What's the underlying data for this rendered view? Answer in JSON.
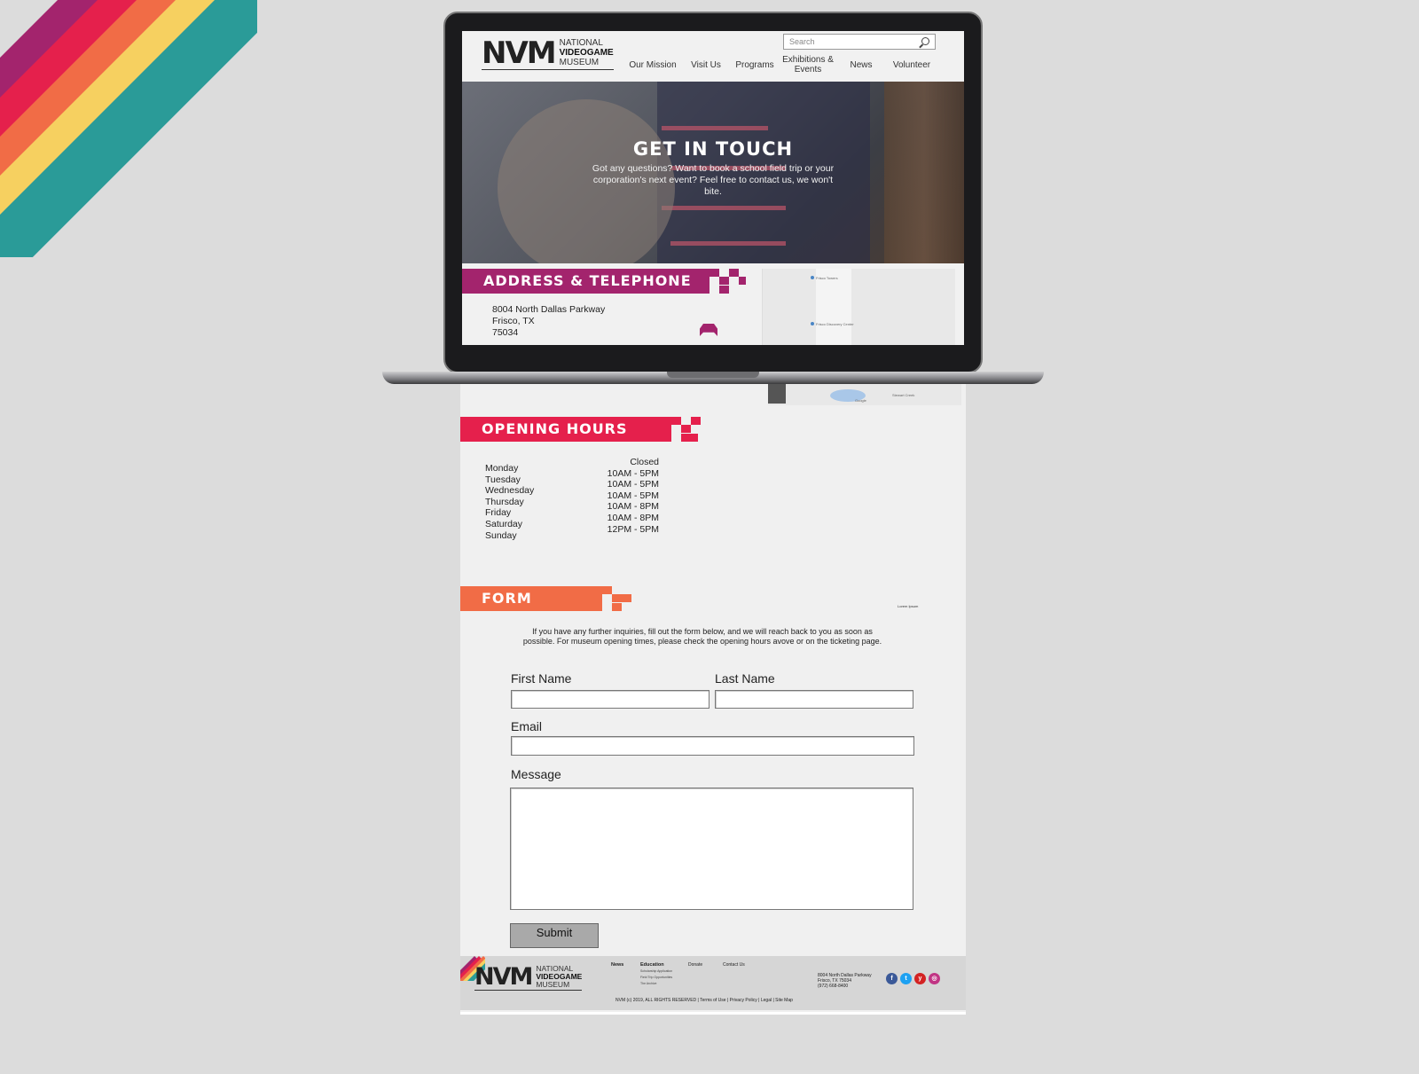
{
  "site": {
    "logo_mark": "NVM",
    "logo_line1": "NATIONAL",
    "logo_line2": "VIDEOGAME",
    "logo_line3": "MUSEUM"
  },
  "header": {
    "search_placeholder": "Search",
    "nav": [
      "Our Mission",
      "Visit Us",
      "Programs",
      "Exhibitions & Events",
      "News",
      "Volunteer"
    ]
  },
  "hero": {
    "title": "GET IN TOUCH",
    "text": "Got any questions? Want to book a school field trip or your corporation's next event? Feel free to contact us, we won't bite."
  },
  "address_section": {
    "title": "ADDRESS & TELEPHONE",
    "line1": "8004 North Dallas Parkway",
    "line2": "Frisco, TX",
    "line3": "75034",
    "map_label1": "Frisco Towers",
    "map_label2": "Frisco Discovery Center",
    "map_google": "Google",
    "map_label3": "Stewart Creek"
  },
  "hours_section": {
    "title": "OPENING HOURS",
    "days": [
      "Monday",
      "Tuesday",
      "Wednesday",
      "Thursday",
      "Friday",
      "Saturday",
      "Sunday"
    ],
    "times": [
      "Closed",
      "10AM - 5PM",
      "10AM - 5PM",
      "10AM - 5PM",
      "10AM - 8PM",
      "10AM - 8PM",
      "12PM - 5PM"
    ]
  },
  "form_section": {
    "title": "FORM",
    "tiny_text": "Lorem Ipsum",
    "intro": "If you have any further inquiries, fill out the form below, and we will reach back to you as soon as possible. For museum opening times, please check the opening hours avove or on the ticketing page.",
    "first_name_label": "First Name",
    "last_name_label": "Last Name",
    "email_label": "Email",
    "message_label": "Message",
    "submit_label": "Submit"
  },
  "footer": {
    "col1": "News",
    "col2_head": "Education",
    "col2_items": [
      "Scholarship Application",
      "Field Trip Opportunities",
      "The Archive"
    ],
    "col3": "Donate",
    "col4": "Contact Us",
    "addr1": "8004 North Dallas Parkway",
    "addr2": "Frisco, TX 75034",
    "phone": "(972) 668-8400",
    "legal": "NVM (c) 2019, ALL RIGHTS RESERVED | Terms of Use | Privacy Policy | Legal | Site Map",
    "social": [
      {
        "icon": "facebook-icon",
        "glyph": "f",
        "color": "#3b5998"
      },
      {
        "icon": "twitter-icon",
        "glyph": "t",
        "color": "#1da1f2"
      },
      {
        "icon": "yelp-icon",
        "glyph": "y",
        "color": "#d32323"
      },
      {
        "icon": "instagram-icon",
        "glyph": "◎",
        "color": "#c13584"
      }
    ]
  },
  "colors": {
    "magenta": "#a3246d",
    "red": "#e5204c",
    "orange": "#f16c46",
    "yellow": "#f6d060",
    "teal": "#2a9b98"
  }
}
